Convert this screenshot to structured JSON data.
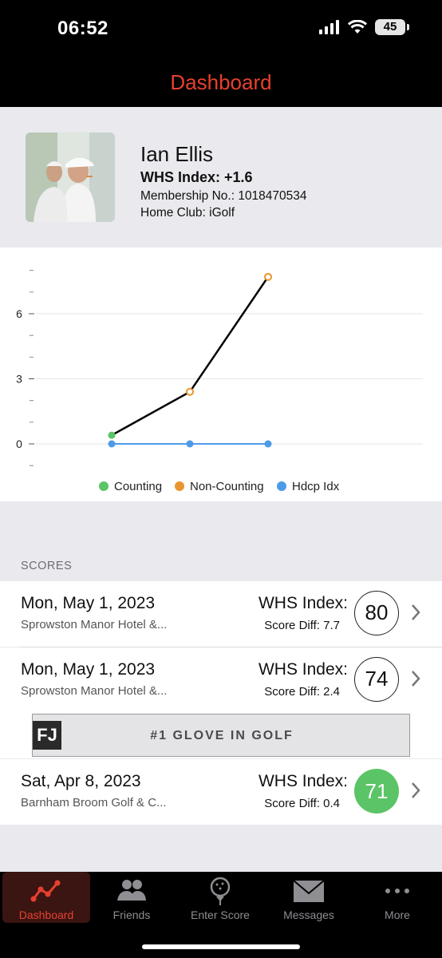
{
  "status_bar": {
    "time": "06:52",
    "battery": "45"
  },
  "nav": {
    "title": "Dashboard"
  },
  "profile": {
    "name": "Ian Ellis",
    "whs_index": "WHS Index: +1.6",
    "membership": "Membership No.: 1018470534",
    "home_club": "Home Club: iGolf"
  },
  "chart_data": {
    "type": "line",
    "x": [
      1,
      2,
      3
    ],
    "ylim": [
      -1.5,
      8.5
    ],
    "y_ticks": [
      "0",
      "3",
      "6"
    ],
    "grid": true,
    "legend_position": "bottom",
    "series": [
      {
        "name": "Counting",
        "color": "#5bc466",
        "points": [
          [
            1,
            0.4
          ]
        ]
      },
      {
        "name": "Non-Counting",
        "color": "#e8952f",
        "points": [
          [
            2,
            2.4
          ],
          [
            3,
            7.7
          ]
        ]
      },
      {
        "name": "Hdcp Idx",
        "color": "#4d9be8",
        "points": [
          [
            1,
            0
          ],
          [
            2,
            0
          ],
          [
            3,
            0
          ]
        ]
      }
    ],
    "score_diff_line": [
      0.4,
      2.4,
      7.7
    ]
  },
  "scores": {
    "header": "SCORES",
    "rows": [
      {
        "date": "Mon, May 1, 2023",
        "course": "Sprowston Manor Hotel &...",
        "whs_label": "WHS Index:",
        "diff": "Score Diff: 7.7",
        "score": "80",
        "counting": false
      },
      {
        "date": "Mon, May 1, 2023",
        "course": "Sprowston Manor Hotel &...",
        "whs_label": "WHS Index:",
        "diff": "Score Diff: 2.4",
        "score": "74",
        "counting": false
      },
      {
        "date": "Sat, Apr 8, 2023",
        "course": "Barnham Broom Golf & C...",
        "whs_label": "WHS Index:",
        "diff": "Score Diff: 0.4",
        "score": "71",
        "counting": true
      }
    ]
  },
  "ad": {
    "logo": "FJ",
    "text": "#1 GLOVE IN GOLF"
  },
  "tabs": [
    {
      "label": "Dashboard",
      "icon": "chart-line-icon",
      "active": true
    },
    {
      "label": "Friends",
      "icon": "friends-icon",
      "active": false
    },
    {
      "label": "Enter Score",
      "icon": "golf-ball-icon",
      "active": false
    },
    {
      "label": "Messages",
      "icon": "envelope-icon",
      "active": false
    },
    {
      "label": "More",
      "icon": "more-dots-icon",
      "active": false
    }
  ]
}
